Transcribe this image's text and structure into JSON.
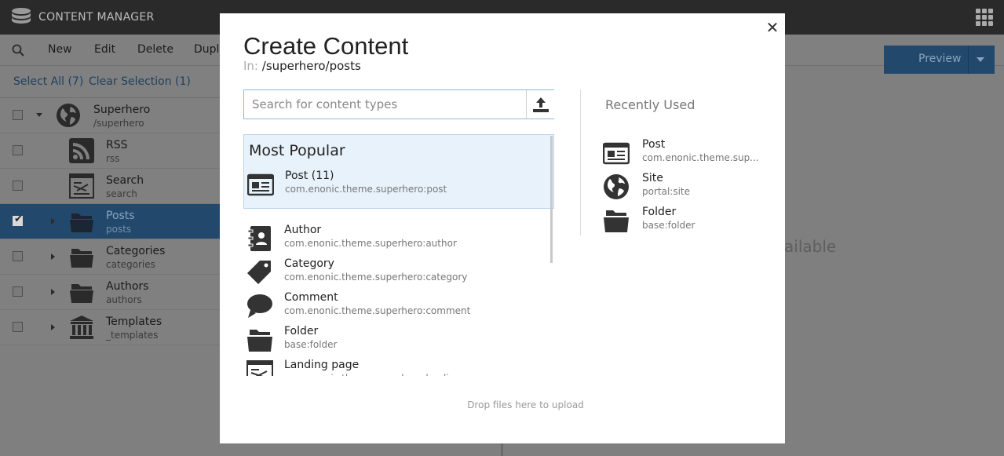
{
  "app": {
    "title": "CONTENT MANAGER"
  },
  "toolbar": {
    "new_label": "New",
    "edit_label": "Edit",
    "delete_label": "Delete",
    "duplicate_label": "Dupli",
    "preview_label": "Preview"
  },
  "selection": {
    "select_all": "Select All (7)",
    "clear_selection": "Clear Selection (1)"
  },
  "tree": {
    "items": [
      {
        "name": "Superhero",
        "path": "/superhero",
        "icon": "globe-icon",
        "checked": false
      },
      {
        "name": "RSS",
        "path": "rss",
        "icon": "rss-icon",
        "checked": false
      },
      {
        "name": "Search",
        "path": "search",
        "icon": "page-icon",
        "checked": false
      },
      {
        "name": "Posts",
        "path": "posts",
        "icon": "folder-icon",
        "checked": true
      },
      {
        "name": "Categories",
        "path": "categories",
        "icon": "folder-icon",
        "checked": false
      },
      {
        "name": "Authors",
        "path": "authors",
        "icon": "folder-icon",
        "checked": false
      },
      {
        "name": "Templates",
        "path": "_templates",
        "icon": "templates-icon",
        "checked": false
      }
    ]
  },
  "background": {
    "available_text": "ailable"
  },
  "modal": {
    "title": "Create Content",
    "path_prefix": "In:",
    "path": "/superhero/posts",
    "search_placeholder": "Search for content types",
    "most_popular_title": "Most Popular",
    "most_popular": [
      {
        "name": "Post (11)",
        "id": "com.enonic.theme.superhero:post",
        "icon": "article-icon"
      }
    ],
    "content_types": [
      {
        "name": "Author",
        "id": "com.enonic.theme.superhero:author",
        "icon": "author-icon"
      },
      {
        "name": "Category",
        "id": "com.enonic.theme.superhero:category",
        "icon": "tag-icon"
      },
      {
        "name": "Comment",
        "id": "com.enonic.theme.superhero:comment",
        "icon": "comment-icon"
      },
      {
        "name": "Folder",
        "id": "base:folder",
        "icon": "folder-icon"
      },
      {
        "name": "Landing page",
        "id": "com.enonic.theme.superhero:landing-page",
        "icon": "page-icon"
      }
    ],
    "recently_used_title": "Recently Used",
    "recently_used": [
      {
        "name": "Post",
        "id": "com.enonic.theme.sup...",
        "icon": "article-icon"
      },
      {
        "name": "Site",
        "id": "portal:site",
        "icon": "globe-icon"
      },
      {
        "name": "Folder",
        "id": "base:folder",
        "icon": "folder-icon"
      }
    ],
    "drop_hint": "Drop files here to upload"
  },
  "colors": {
    "accent": "#22496c",
    "popular_bg": "#e8f2fb",
    "topbar": "#2a2a2a"
  }
}
